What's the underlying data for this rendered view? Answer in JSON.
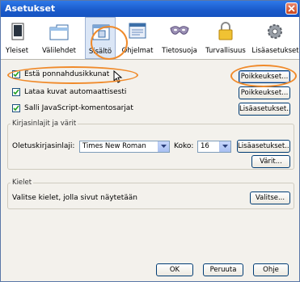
{
  "window": {
    "title": "Asetukset"
  },
  "toolbar": {
    "items": [
      {
        "label": "Yleiset",
        "icon": "general-icon"
      },
      {
        "label": "Välilehdet",
        "icon": "tabs-icon"
      },
      {
        "label": "Sisältö",
        "icon": "content-icon",
        "selected": true
      },
      {
        "label": "Ohjelmat",
        "icon": "applications-icon"
      },
      {
        "label": "Tietosuoja",
        "icon": "privacy-mask-icon"
      },
      {
        "label": "Turvallisuus",
        "icon": "padlock-icon"
      },
      {
        "label": "Lisäasetukset",
        "icon": "gear-icon"
      }
    ]
  },
  "content": {
    "block_popups": {
      "label": "Estä ponnahdusikkunat",
      "checked": true,
      "button": "Poikkeukset..."
    },
    "load_images": {
      "label": "Lataa kuvat automaattisesti",
      "checked": true,
      "button": "Poikkeukset..."
    },
    "javascript": {
      "label": "Salli JavaScript-komentosarjat",
      "checked": true,
      "button": "Lisäasetukset..."
    }
  },
  "fonts": {
    "group_title": "Kirjasinlajit ja värit",
    "default_font_label": "Oletuskirjasinlaji:",
    "default_font_value": "Times New Roman",
    "size_label": "Koko:",
    "size_value": "16",
    "advanced_button": "Lisäasetukset...",
    "colors_button": "Värit..."
  },
  "languages": {
    "group_title": "Kielet",
    "description": "Valitse kielet, jolla sivut näytetään",
    "choose_button": "Valitse..."
  },
  "footer": {
    "ok": "OK",
    "cancel": "Peruuta",
    "help": "Ohje"
  },
  "colors": {
    "titlebar": "#1b5ccc",
    "highlight": "#f08a2a",
    "selected_tab": "#dbe6f6"
  }
}
